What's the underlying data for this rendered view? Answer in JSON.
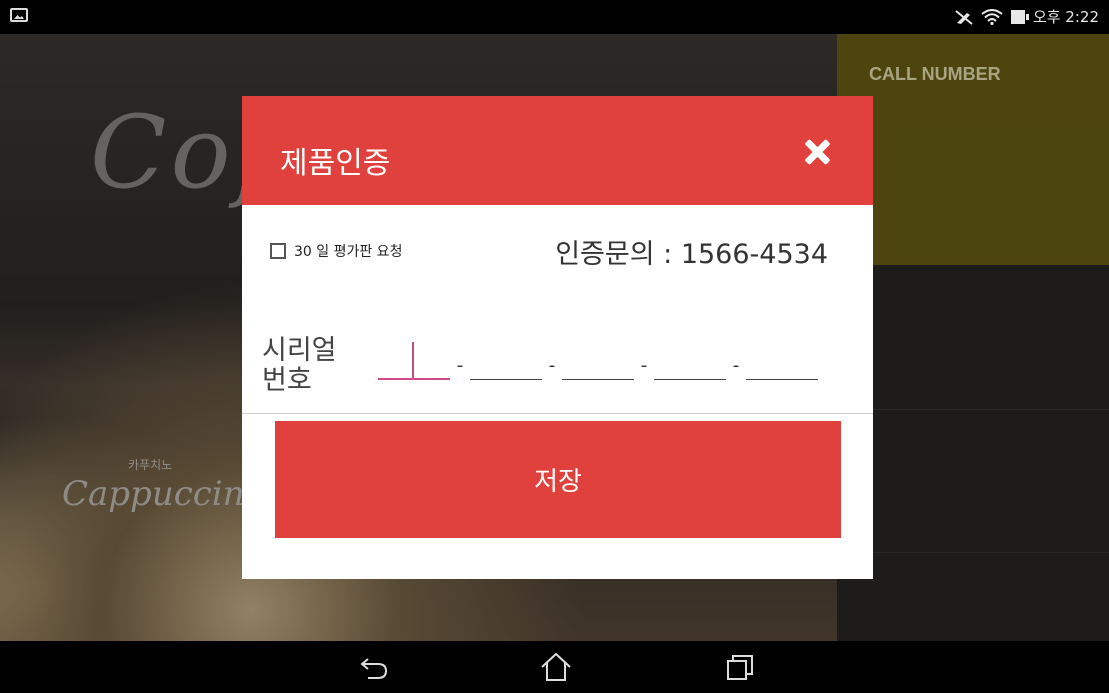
{
  "status_bar": {
    "time": "오후 2:22",
    "icons": [
      "image-icon",
      "mute-icon",
      "wifi-icon",
      "battery-icon"
    ]
  },
  "background_app": {
    "hero_script": "Cof",
    "product_script": "Cappuccino",
    "product_korean": "카푸치노",
    "sidebar_label": "CALL NUMBER",
    "colors": {
      "sidebar_accent": "#6b6013",
      "sidebar_dark": "#2a2826"
    }
  },
  "dialog": {
    "title": "제품인증",
    "close_icon": "close-icon",
    "eval_checkbox": {
      "label": "30 일 평가판 요청",
      "checked": false
    },
    "inquiry": "인증문의 : 1566-4534",
    "serial_label": "시리얼 번호",
    "serial_segments": [
      "",
      "",
      "",
      "",
      ""
    ],
    "serial_separator": "-",
    "save_label": "저장",
    "colors": {
      "accent": "#e0413d",
      "focus": "#d14a8a"
    }
  },
  "nav_bar": {
    "buttons": [
      "back-icon",
      "home-icon",
      "recent-apps-icon"
    ]
  }
}
